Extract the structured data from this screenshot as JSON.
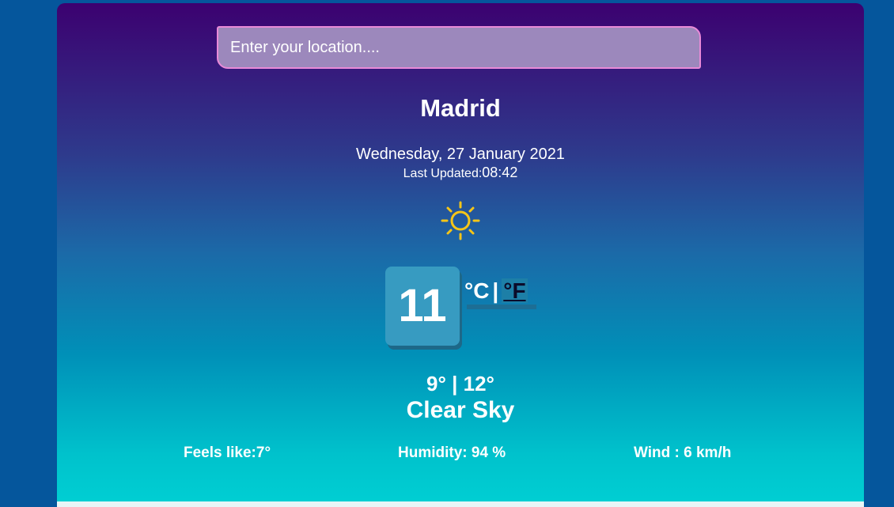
{
  "search": {
    "placeholder": "Enter your location...."
  },
  "location": {
    "city": "Madrid"
  },
  "date": {
    "text": "Wednesday, 27 January 2021",
    "last_updated_label": "Last Updated:",
    "last_updated_time": "08:42"
  },
  "weather": {
    "icon": "sun-icon",
    "temperature": "11",
    "unit_c": "°C",
    "unit_separator": "|",
    "unit_f": "°F",
    "min_max": "9° | 12°",
    "description": "Clear Sky"
  },
  "details": {
    "feels_like": "Feels like:7°",
    "humidity": "Humidity: 94 %",
    "wind": "Wind : 6 km/h"
  },
  "colors": {
    "gradient_top": "#3c0170",
    "gradient_bottom": "#00cfd3",
    "sun": "#f5c518",
    "page_background": "#05569c"
  }
}
